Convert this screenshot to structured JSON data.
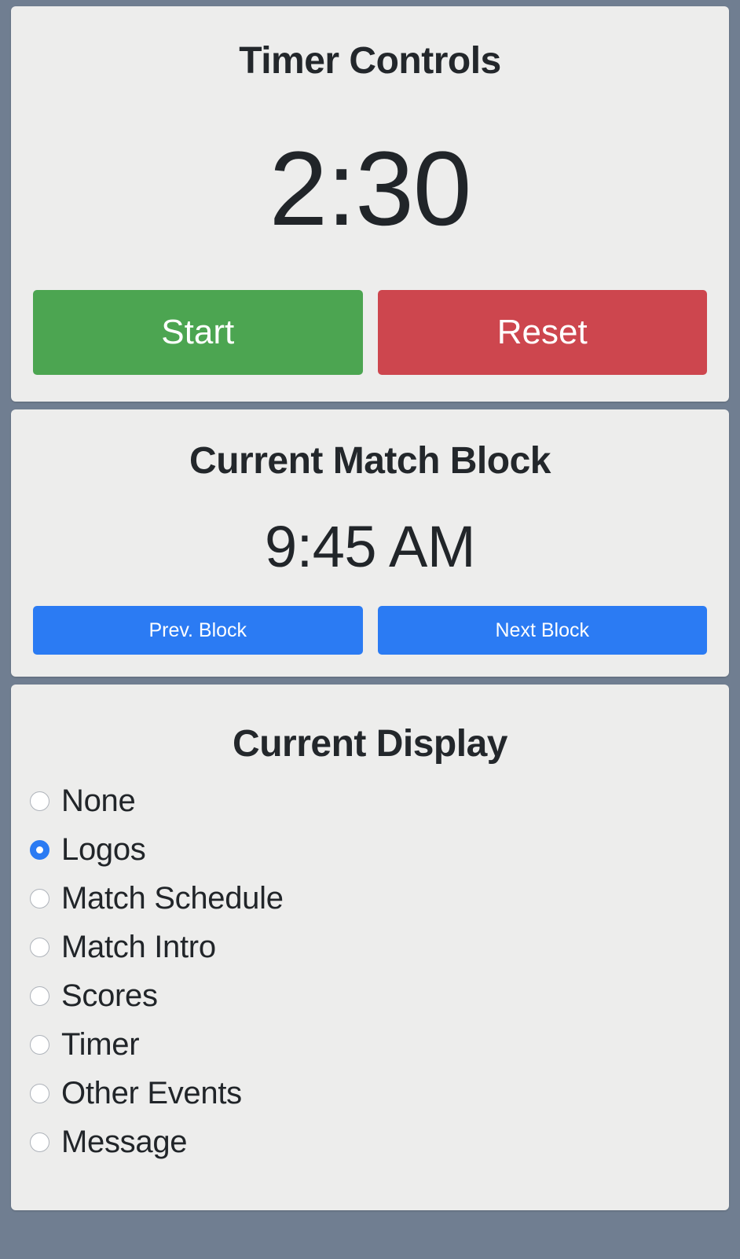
{
  "colors": {
    "page_background": "#707E91",
    "panel_background": "#EDEDEC",
    "start_green": "#4CA551",
    "reset_red": "#CD464E",
    "block_blue": "#2B7BF3",
    "text_dark": "#212529",
    "radio_selected": "#2B7BF3"
  },
  "timer_panel": {
    "title": "Timer Controls",
    "time_remaining": "2:30",
    "start_label": "Start",
    "reset_label": "Reset"
  },
  "match_block_panel": {
    "title": "Current Match Block",
    "block_time": "9:45 AM",
    "prev_label": "Prev. Block",
    "next_label": "Next Block"
  },
  "display_panel": {
    "title": "Current Display",
    "selected": "Logos",
    "options": [
      {
        "label": "None",
        "selected": false
      },
      {
        "label": "Logos",
        "selected": true
      },
      {
        "label": "Match Schedule",
        "selected": false
      },
      {
        "label": "Match Intro",
        "selected": false
      },
      {
        "label": "Scores",
        "selected": false
      },
      {
        "label": "Timer",
        "selected": false
      },
      {
        "label": "Other Events",
        "selected": false
      },
      {
        "label": "Message",
        "selected": false
      }
    ]
  }
}
